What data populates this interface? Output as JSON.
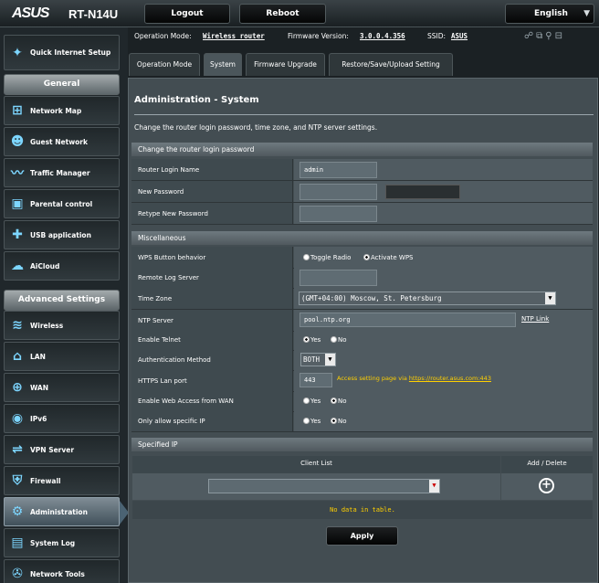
{
  "header": {
    "brand": "ASUS",
    "model": "RT-N14U",
    "logout_label": "Logout",
    "reboot_label": "Reboot",
    "language": "English"
  },
  "info": {
    "op_mode_label": "Operation Mode:",
    "op_mode_value": "Wireless router",
    "firmware_label": "Firmware Version:",
    "firmware_value": "3.0.0.4.356",
    "ssid_label": "SSID:",
    "ssid_value": "ASUS"
  },
  "sidebar": {
    "quick_setup": "Quick Internet Setup",
    "general_header": "General",
    "general_items": [
      {
        "label": "Network Map",
        "icon": "network-map-icon"
      },
      {
        "label": "Guest Network",
        "icon": "guest-network-icon"
      },
      {
        "label": "Traffic Manager",
        "icon": "traffic-manager-icon"
      },
      {
        "label": "Parental control",
        "icon": "lock-icon"
      },
      {
        "label": "USB application",
        "icon": "puzzle-icon"
      },
      {
        "label": "AiCloud",
        "icon": "cloud-icon"
      }
    ],
    "advanced_header": "Advanced Settings",
    "advanced_items": [
      {
        "label": "Wireless",
        "icon": "wifi-icon"
      },
      {
        "label": "LAN",
        "icon": "home-icon"
      },
      {
        "label": "WAN",
        "icon": "globe-icon"
      },
      {
        "label": "IPv6",
        "icon": "ipv6-icon"
      },
      {
        "label": "VPN Server",
        "icon": "vpn-icon"
      },
      {
        "label": "Firewall",
        "icon": "shield-icon"
      },
      {
        "label": "Administration",
        "icon": "admin-icon"
      },
      {
        "label": "System Log",
        "icon": "log-icon"
      },
      {
        "label": "Network Tools",
        "icon": "tools-icon"
      }
    ]
  },
  "tabs": [
    "Operation Mode",
    "System",
    "Firmware Upgrade",
    "Restore/Save/Upload Setting"
  ],
  "page": {
    "title": "Administration - System",
    "description": "Change the router login password, time zone, and NTP server settings."
  },
  "login_section": {
    "header": "Change the router login password",
    "login_name_label": "Router Login Name",
    "login_name_value": "admin",
    "new_password_label": "New Password",
    "retype_password_label": "Retype New Password"
  },
  "misc_section": {
    "header": "Miscellaneous",
    "wps_label": "WPS Button behavior",
    "wps_opt1": "Toggle Radio",
    "wps_opt2": "Activate WPS",
    "remote_log_label": "Remote Log Server",
    "timezone_label": "Time Zone",
    "timezone_value": "(GMT+04:00) Moscow, St. Petersburg",
    "ntp_label": "NTP Server",
    "ntp_value": "pool.ntp.org",
    "ntp_link": "NTP Link",
    "telnet_label": "Enable Telnet",
    "auth_label": "Authentication Method",
    "auth_value": "BOTH",
    "https_label": "HTTPS Lan port",
    "https_value": "443",
    "https_hint": "Access setting page via ",
    "https_url": "https://router.asus.com:443",
    "web_wan_label": "Enable Web Access from WAN",
    "only_ip_label": "Only allow specific IP",
    "yes": "Yes",
    "no": "No"
  },
  "specified_ip": {
    "header": "Specified IP",
    "col_client": "Client List",
    "col_action": "Add / Delete",
    "empty": "No data in table."
  },
  "apply_label": "Apply"
}
